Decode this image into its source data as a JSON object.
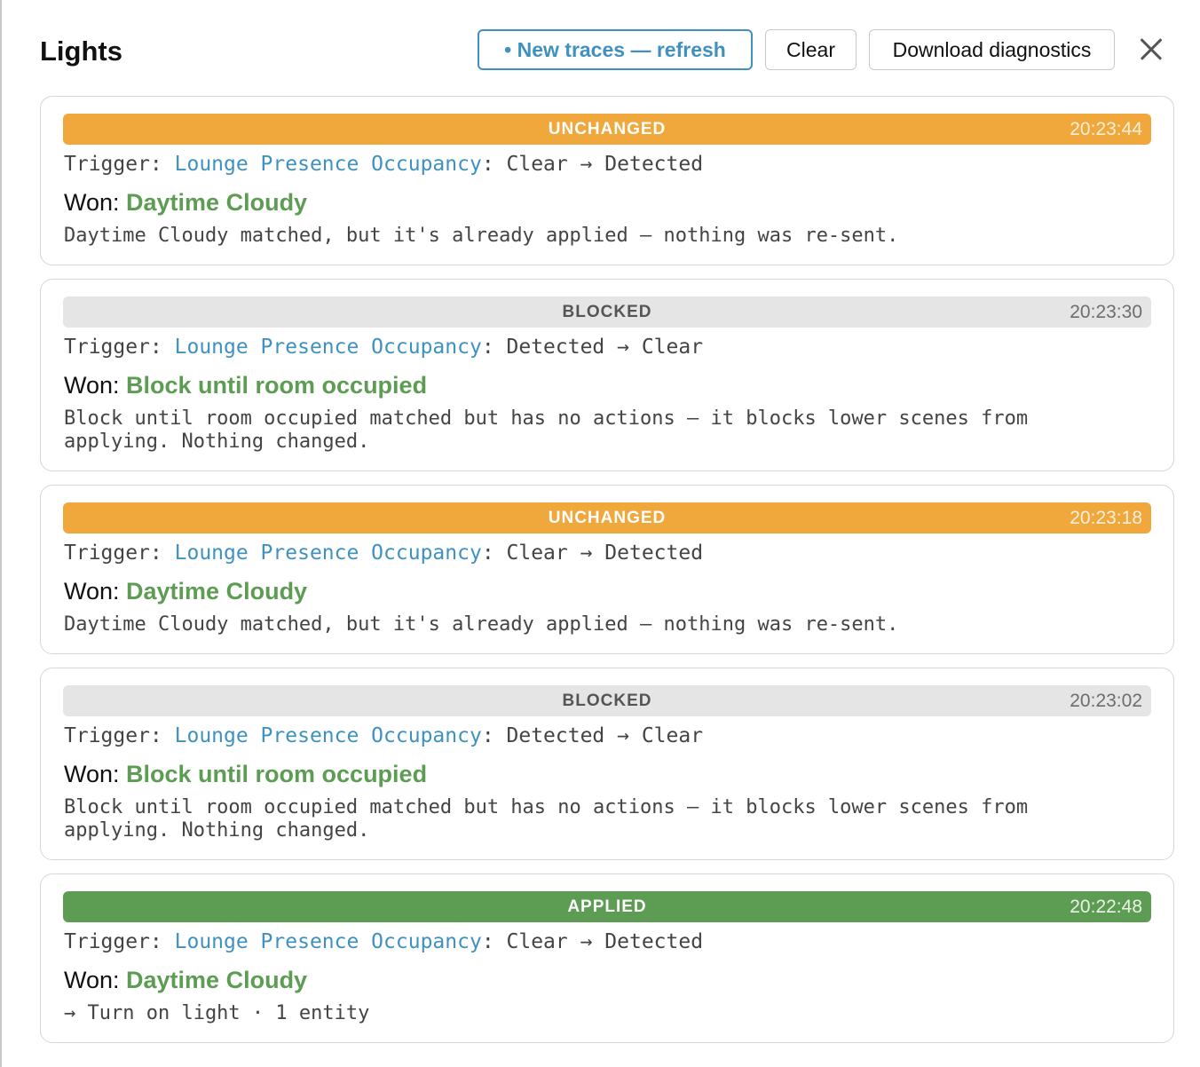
{
  "panel": {
    "title": "Lights",
    "refresh_label": "• New traces — refresh",
    "clear_label": "Clear",
    "download_label": "Download diagnostics",
    "close_icon": "close-icon"
  },
  "labels": {
    "trigger_prefix": "Trigger: ",
    "won_prefix": "Won: "
  },
  "colors": {
    "unchanged": "#f0a83c",
    "blocked": "#e5e5e5",
    "applied": "#5d9d53",
    "link": "#3f92c0",
    "scene": "#5d9d53"
  },
  "traces": [
    {
      "status": "UNCHANGED",
      "time": "20:23:44",
      "trigger_entity": "Lounge Presence Occupancy",
      "transition": ": Clear → Detected",
      "won_scene": "Daytime Cloudy",
      "detail": "Daytime Cloudy matched, but it's already applied — nothing was re-sent."
    },
    {
      "status": "BLOCKED",
      "time": "20:23:30",
      "trigger_entity": "Lounge Presence Occupancy",
      "transition": ": Detected → Clear",
      "won_scene": "Block until room occupied",
      "detail": "Block until room occupied matched but has no actions — it blocks lower scenes from applying. Nothing changed."
    },
    {
      "status": "UNCHANGED",
      "time": "20:23:18",
      "trigger_entity": "Lounge Presence Occupancy",
      "transition": ": Clear → Detected",
      "won_scene": "Daytime Cloudy",
      "detail": "Daytime Cloudy matched, but it's already applied — nothing was re-sent."
    },
    {
      "status": "BLOCKED",
      "time": "20:23:02",
      "trigger_entity": "Lounge Presence Occupancy",
      "transition": ": Detected → Clear",
      "won_scene": "Block until room occupied",
      "detail": "Block until room occupied matched but has no actions — it blocks lower scenes from applying. Nothing changed."
    },
    {
      "status": "APPLIED",
      "time": "20:22:48",
      "trigger_entity": "Lounge Presence Occupancy",
      "transition": ": Clear → Detected",
      "won_scene": "Daytime Cloudy",
      "detail": "→ Turn on light · 1 entity"
    }
  ]
}
